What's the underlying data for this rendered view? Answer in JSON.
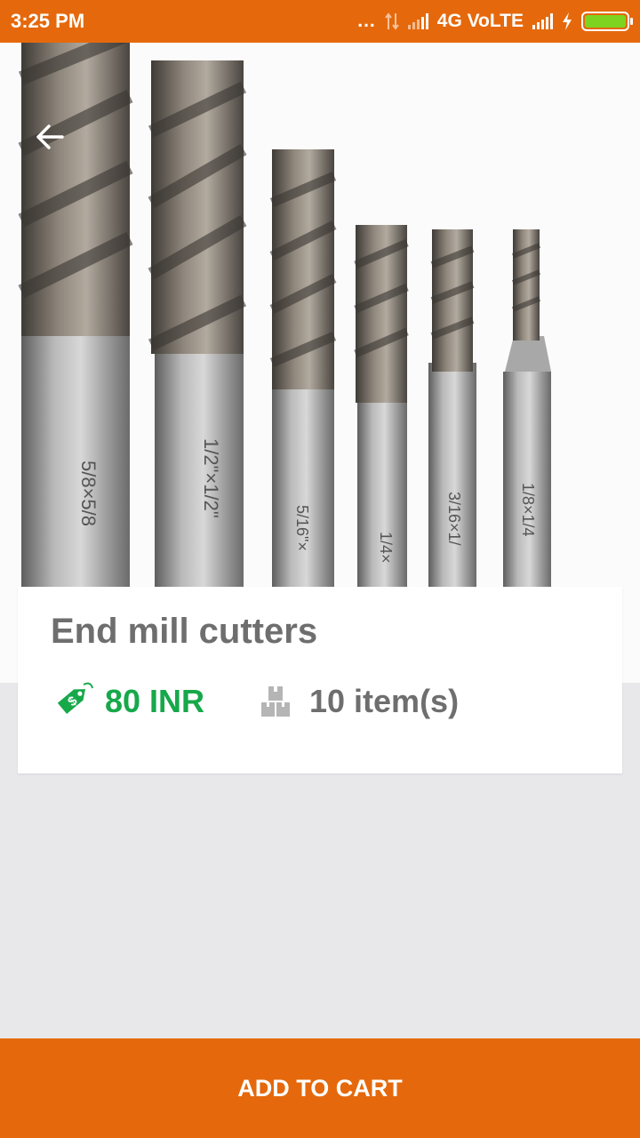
{
  "status_bar": {
    "time": "3:25 PM",
    "network_label": "4G VoLTE",
    "dots": "...",
    "battery_color": "#7ed321"
  },
  "theme": {
    "accent": "#e5690c",
    "price_color": "#17a84a",
    "text_gray": "#6e6e6e",
    "page_bg": "#e8e7ea"
  },
  "hero": {
    "image_desc_icon": "end-mill-cutters-photo",
    "shank_markings": [
      "5/8×5/8",
      "1/2\"×1/2\"",
      "5/16\"×",
      "1/4×",
      "3/16×1/",
      "1/8×1/4"
    ]
  },
  "product": {
    "name": "End mill cutters",
    "price": "80 INR",
    "stock": "10 item(s)",
    "price_icon": "price-tag-icon",
    "stock_icon": "boxes-icon"
  },
  "actions": {
    "back_icon": "arrow-left-icon",
    "add_to_cart": "ADD TO CART"
  }
}
